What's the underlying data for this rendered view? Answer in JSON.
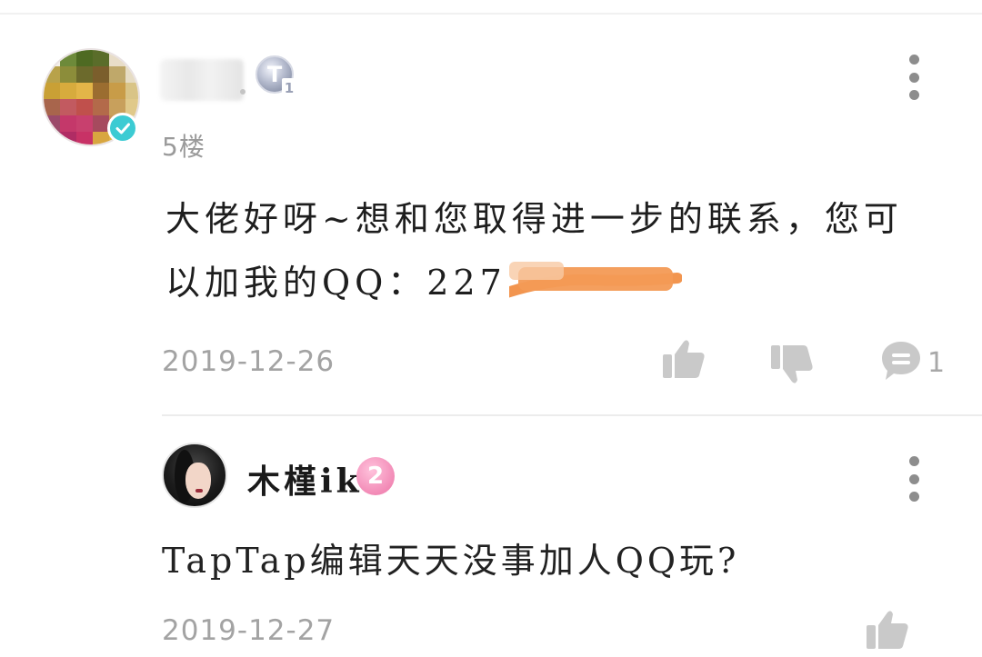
{
  "main_comment": {
    "floor": "5楼",
    "text": "大佬好呀~想和您取得进一步的联系，您可以加我的QQ：227",
    "date": "2019-12-26",
    "level_badge_letter": "T",
    "level_badge_number": "1",
    "reply_count": "1",
    "verified_color": "#3ccbd3"
  },
  "reply": {
    "username": "木槿ik",
    "level": "2",
    "text": "TapTap编辑天天没事加人QQ玩?",
    "date": "2019-12-27",
    "level_badge_color": "#f28ab6"
  },
  "icons": {
    "more": "more-vertical-icon",
    "like": "thumbs-up-icon",
    "dislike": "thumbs-down-icon",
    "reply": "comment-bubble-icon",
    "verified": "check-badge-icon"
  },
  "colors": {
    "icon_gray": "#c9c9c9",
    "text_gray": "#a3a3a3",
    "redaction_orange": "#f2954f"
  }
}
